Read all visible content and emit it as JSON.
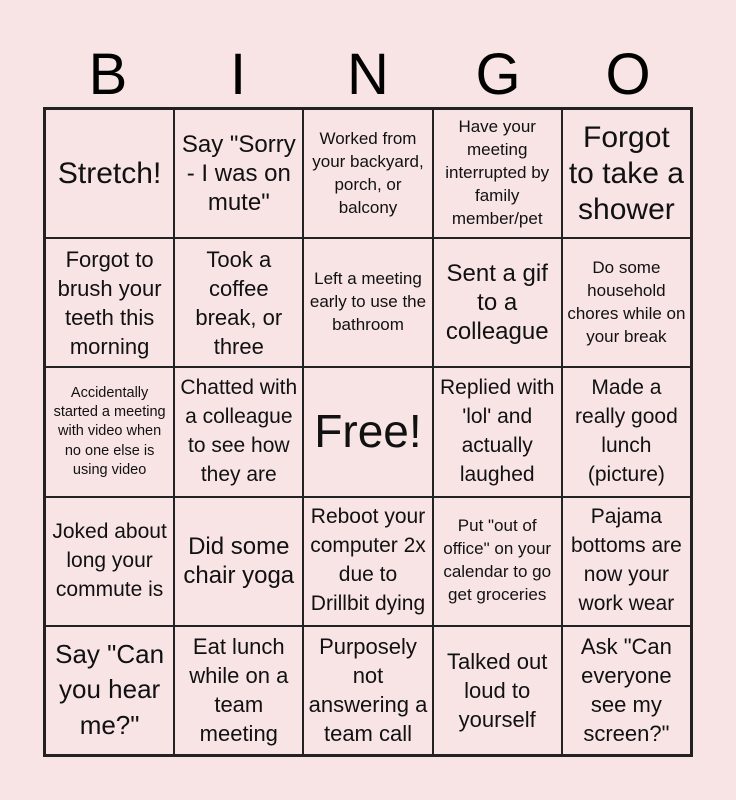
{
  "title_letters": [
    "B",
    "I",
    "N",
    "G",
    "O"
  ],
  "colors": {
    "background": "#f8e4e5",
    "grid_line": "#222222",
    "text": "#111111"
  },
  "cells": [
    [
      "Stretch!",
      "Say \"Sorry - I was on mute\"",
      "Worked from your backyard, porch, or balcony",
      "Have your meeting interrupted by family member/pet",
      "Forgot to take a shower"
    ],
    [
      "Forgot to brush your teeth this morning",
      "Took a coffee break, or three",
      "Left a meeting early to use the bathroom",
      "Sent a gif to a colleague",
      "Do some household chores while on your break"
    ],
    [
      "Accidentally started a meeting with video when no one else is using video",
      "Chatted with a colleague to see how they are",
      "Free!",
      "Replied with 'lol' and actually laughed",
      "Made a really good lunch (picture)"
    ],
    [
      "Joked about long your commute is",
      "Did some chair yoga",
      "Reboot your computer 2x due to Drillbit dying",
      "Put \"out of office\" on your calendar to go get groceries",
      "Pajama bottoms are now your work wear"
    ],
    [
      "Say \"Can you hear me?\"",
      "Eat lunch while on a team meeting",
      "Purposely not answering a team call",
      "Talked out loud to yourself",
      "Ask \"Can everyone see my screen?\""
    ]
  ]
}
